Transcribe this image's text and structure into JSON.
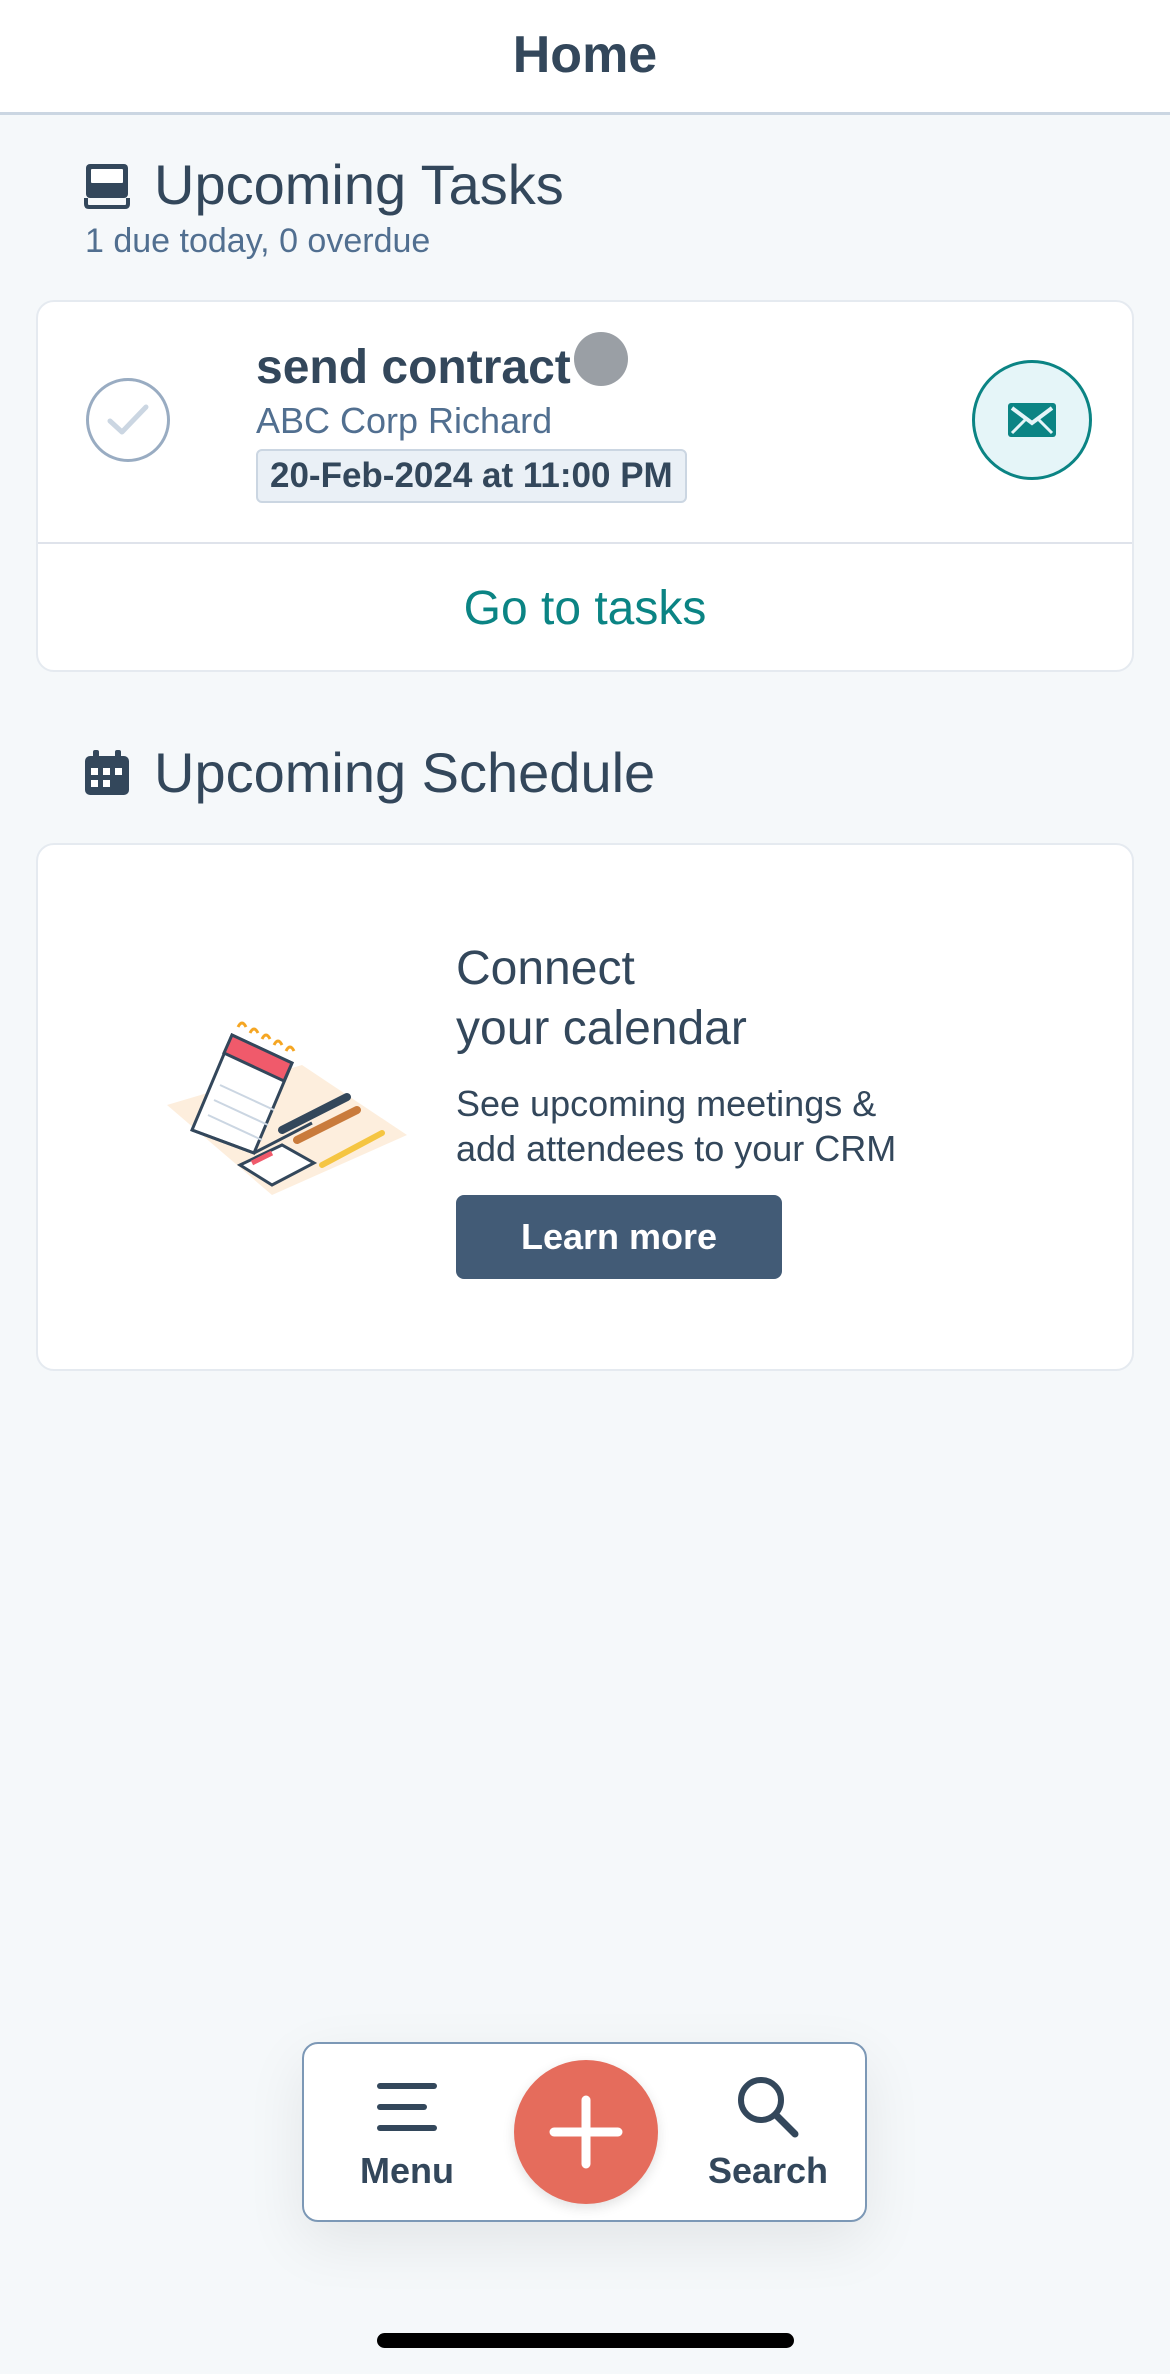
{
  "header": {
    "title": "Home"
  },
  "tasks_section": {
    "title": "Upcoming Tasks",
    "icon": "inbox-tray-icon",
    "summary": "1 due today, 0 overdue",
    "task": {
      "title": "send contract",
      "subtitle": "ABC Corp Richard",
      "due": "20-Feb-2024 at 11:00 PM",
      "action_icon": "email-icon"
    },
    "goto_label": "Go to tasks"
  },
  "schedule_section": {
    "title": "Upcoming Schedule",
    "icon": "calendar-icon",
    "heading_line1": "Connect",
    "heading_line2": "your calendar",
    "desc_line1": "See upcoming meetings &",
    "desc_line2": "add attendees to your CRM",
    "button_label": "Learn more"
  },
  "bottom_nav": {
    "menu_label": "Menu",
    "search_label": "Search",
    "add_icon": "plus-icon"
  },
  "colors": {
    "accent_teal": "#0b8484",
    "fab_coral": "#e56c5c",
    "button_slate": "#425b76",
    "text_dark": "#33475b"
  }
}
